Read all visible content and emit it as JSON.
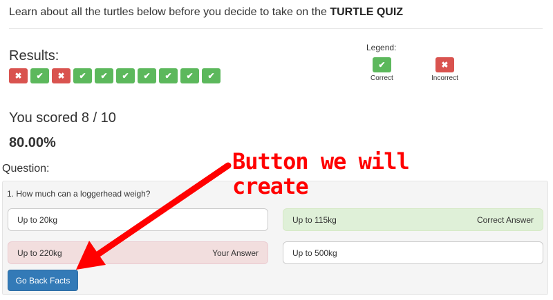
{
  "intro": {
    "text": "Learn about all the turtles below before you decide to take on the ",
    "quiz_name": "TURTLE QUIZ"
  },
  "results": {
    "title": "Results:",
    "badges": [
      "incorrect",
      "correct",
      "incorrect",
      "correct",
      "correct",
      "correct",
      "correct",
      "correct",
      "correct",
      "correct"
    ]
  },
  "legend": {
    "title": "Legend:",
    "correct_label": "Correct",
    "incorrect_label": "Incorrect"
  },
  "score": {
    "text": "You scored 8 / 10",
    "percent": "80.00%"
  },
  "question": {
    "section_label": "Question:",
    "text": "1. How much can a loggerhead weigh?",
    "answers": [
      {
        "label": "Up to 20kg",
        "tag": "",
        "state": "neutral"
      },
      {
        "label": "Up to 115kg",
        "tag": "Correct Answer",
        "state": "correct"
      },
      {
        "label": "Up to 220kg",
        "tag": "Your Answer",
        "state": "wrong"
      },
      {
        "label": "Up to 500kg",
        "tag": "",
        "state": "neutral"
      }
    ]
  },
  "button": {
    "label": "Go Back Facts"
  },
  "annotation": {
    "line1": "Button we will",
    "line2": "create",
    "color": "#ff0000"
  },
  "colors": {
    "success": "#5cb85c",
    "danger": "#d9534f",
    "primary": "#337ab7"
  },
  "icons": {
    "correct": "check-icon",
    "incorrect": "x-icon"
  }
}
